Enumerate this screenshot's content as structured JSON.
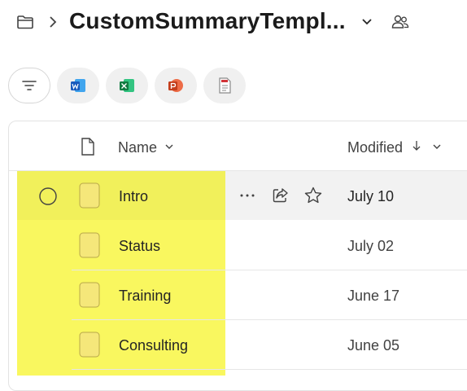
{
  "header": {
    "title": "CustomSummaryTempl...",
    "icons": [
      "folder-icon",
      "chevron-right-icon",
      "chevron-down-icon",
      "share-people-icon"
    ]
  },
  "filters": [
    {
      "name": "filter-icon"
    },
    {
      "name": "word-icon",
      "color": "#185ABD"
    },
    {
      "name": "excel-icon",
      "color": "#107C41"
    },
    {
      "name": "powerpoint-icon",
      "color": "#C43E1C"
    },
    {
      "name": "pdf-icon",
      "color": "#D13438"
    }
  ],
  "table": {
    "columns": {
      "name_label": "Name",
      "modified_label": "Modified",
      "sort": "descending"
    },
    "rows": [
      {
        "name": "Intro",
        "modified": "July 10"
      },
      {
        "name": "Status",
        "modified": "July 02"
      },
      {
        "name": "Training",
        "modified": "June 17"
      },
      {
        "name": "Consulting",
        "modified": "June 05"
      }
    ],
    "row_actions": [
      "more-icon",
      "share-icon",
      "favorite-icon"
    ]
  },
  "colors": {
    "highlight": "#f9f75f",
    "folder_fill": "#f5e77a"
  }
}
